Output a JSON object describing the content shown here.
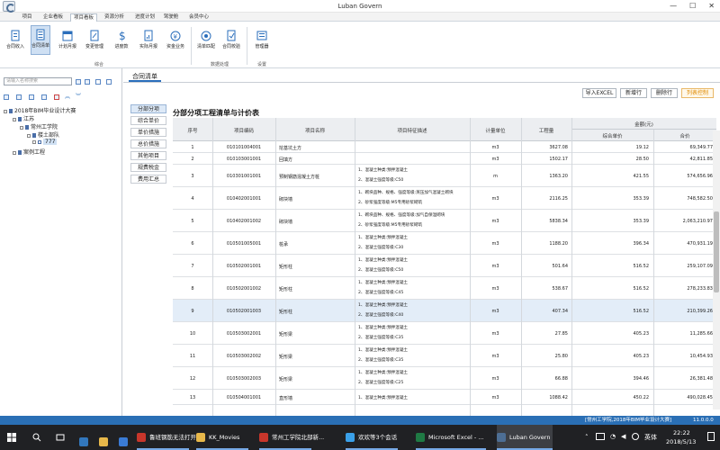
{
  "window": {
    "title": "Luban Govern",
    "controls": [
      "—",
      "☐",
      "✕"
    ]
  },
  "menu": {
    "tabs": [
      "项目",
      "企业看板",
      "项目看板",
      "资源分析",
      "进度计划",
      "驾驶舱",
      "会员中心"
    ],
    "active": 2
  },
  "toolbar": {
    "buttons": [
      {
        "label": "合同收入",
        "icon": "contract-income-icon",
        "color": "#2a6ebb"
      },
      {
        "label": "合同清单",
        "icon": "contract-list-icon",
        "color": "#2a6ebb"
      },
      {
        "label": "计划月报",
        "icon": "monthly-plan-icon",
        "color": "#2a6ebb"
      },
      {
        "label": "变更管理",
        "icon": "change-management-icon",
        "color": "#2a6ebb"
      },
      {
        "label": "进度款",
        "icon": "progress-payment-icon",
        "color": "#2a6ebb"
      },
      {
        "label": "实际月报",
        "icon": "actual-monthly-icon",
        "color": "#2a6ebb"
      },
      {
        "label": "资金业务",
        "icon": "funds-icon",
        "color": "#2a6ebb"
      },
      {
        "label": "清单匹配",
        "icon": "list-match-icon",
        "color": "#2a6ebb"
      },
      {
        "label": "合同校验",
        "icon": "contract-check-icon",
        "color": "#2a6ebb"
      },
      {
        "label": "管理器",
        "icon": "manager-icon",
        "color": "#2a6ebb"
      }
    ],
    "active": 1,
    "groups": [
      "综合",
      "数据处理",
      "设置"
    ]
  },
  "left": {
    "search_placeholder": "请输入名称搜索",
    "tree": [
      {
        "label": "2018年BIM毕业设计大赛",
        "level": 0,
        "kind": "folder"
      },
      {
        "label": "江苏",
        "level": 1,
        "kind": "building"
      },
      {
        "label": "常州工学院",
        "level": 2,
        "kind": "building"
      },
      {
        "label": "楼土部队",
        "level": 3,
        "kind": "building"
      },
      {
        "label": "777",
        "level": 4,
        "kind": "item"
      },
      {
        "label": "案例工程",
        "level": 1,
        "kind": "building"
      }
    ]
  },
  "main": {
    "tab": "合同清单",
    "side_buttons": [
      "分部分项",
      "综合单价",
      "单价措施",
      "总价措施",
      "其他项目",
      "规费税金",
      "费用汇总"
    ],
    "side_active": 0,
    "actions": [
      "导入EXCEL",
      "新增行",
      "删除行",
      "列表控制"
    ],
    "section_title": "分部分项工程清单与计价表",
    "headers": {
      "seq": "序号",
      "code": "项目编码",
      "name": "项目名称",
      "feature": "项目特征描述",
      "unit": "计量单位",
      "qty": "工程量",
      "amount": "金额(元)",
      "unit_price": "综合单价",
      "total": "合价"
    },
    "rows": [
      {
        "seq": "1",
        "code": "010101004001",
        "name": "挖基坑土方",
        "features": [],
        "unit": "m3",
        "qty": "3627.08",
        "unit_price": "19.12",
        "total": "69,349.77"
      },
      {
        "seq": "2",
        "code": "010103001001",
        "name": "回填方",
        "features": [],
        "unit": "m3",
        "qty": "1502.17",
        "unit_price": "28.50",
        "total": "42,811.85"
      },
      {
        "seq": "3",
        "code": "010301001001",
        "name": "预制钢筋混凝土方桩",
        "features": [
          "1、混凝土种类:预拌混凝土",
          "2、混凝土强度等级:C50"
        ],
        "unit": "m",
        "qty": "1363.20",
        "unit_price": "421.55",
        "total": "574,656.96"
      },
      {
        "seq": "4",
        "code": "010402001001",
        "name": "砌块墙",
        "features": [
          "1、砌块品种、规格、强度等级:蒸压加气混凝土砌块",
          "2、砂浆强度等级:M5专用砂浆砌筑"
        ],
        "unit": "m3",
        "qty": "2116.25",
        "unit_price": "353.39",
        "total": "748,582.50"
      },
      {
        "seq": "5",
        "code": "010402001002",
        "name": "砌块墙",
        "features": [
          "1、砌块品种、规格、强度等级:加气自保温砌块",
          "2、砂浆强度等级:M5专用砂浆砌筑"
        ],
        "unit": "m3",
        "qty": "5838.34",
        "unit_price": "353.39",
        "total": "2,063,210.97"
      },
      {
        "seq": "6",
        "code": "010501005001",
        "name": "桩承",
        "features": [
          "1、混凝土种类:预拌混凝土",
          "2、混凝土强度等级:C30"
        ],
        "unit": "m3",
        "qty": "1188.20",
        "unit_price": "396.34",
        "total": "470,931.19"
      },
      {
        "seq": "7",
        "code": "010502001001",
        "name": "矩形柱",
        "features": [
          "1、混凝土种类:预拌混凝土",
          "2、混凝土强度等级:C50"
        ],
        "unit": "m3",
        "qty": "501.64",
        "unit_price": "516.52",
        "total": "259,107.09"
      },
      {
        "seq": "8",
        "code": "010502001002",
        "name": "矩形柱",
        "features": [
          "1、混凝土种类:预拌混凝土",
          "2、混凝土强度等级:C45"
        ],
        "unit": "m3",
        "qty": "538.67",
        "unit_price": "516.52",
        "total": "278,233.83"
      },
      {
        "seq": "9",
        "code": "010502001003",
        "name": "矩形柱",
        "features": [
          "1、混凝土种类:预拌混凝土",
          "2、混凝土强度等级:C40"
        ],
        "unit": "m3",
        "qty": "407.34",
        "unit_price": "516.52",
        "total": "210,399.26"
      },
      {
        "seq": "10",
        "code": "010503002001",
        "name": "矩形梁",
        "features": [
          "1、混凝土种类:预拌混凝土",
          "2、混凝土强度等级:C35"
        ],
        "unit": "m3",
        "qty": "27.85",
        "unit_price": "405.23",
        "total": "11,285.66"
      },
      {
        "seq": "11",
        "code": "010503002002",
        "name": "矩形梁",
        "features": [
          "1、混凝土种类:预拌混凝土",
          "2、混凝土强度等级:C35"
        ],
        "unit": "m3",
        "qty": "25.80",
        "unit_price": "405.23",
        "total": "10,454.93"
      },
      {
        "seq": "12",
        "code": "010503002003",
        "name": "矩形梁",
        "features": [
          "1、混凝土种类:预拌混凝土",
          "2、混凝土强度等级:C25"
        ],
        "unit": "m3",
        "qty": "66.88",
        "unit_price": "394.46",
        "total": "26,381.48"
      },
      {
        "seq": "13",
        "code": "010504001001",
        "name": "直形墙",
        "features": [
          "1、混凝土种类:预拌混凝土"
        ],
        "unit": "m3",
        "qty": "1088.42",
        "unit_price": "450.22",
        "total": "490,028.45"
      }
    ],
    "selected_row": 8
  },
  "status": {
    "project": "[常州工学院,2018年BIM毕业设计大赛]",
    "version": "11.0.0.0"
  },
  "taskbar": {
    "items": [
      {
        "label": "",
        "icon": "start-icon",
        "color": "#ffffff"
      },
      {
        "label": "",
        "icon": "search-icon",
        "color": "#ffffff"
      },
      {
        "label": "",
        "icon": "task-view-icon",
        "color": "#ffffff"
      },
      {
        "label": "",
        "icon": "edge-icon",
        "color": "#3277bc"
      },
      {
        "label": "",
        "icon": "explorer-icon",
        "color": "#e8b84a"
      },
      {
        "label": "",
        "icon": "store-icon",
        "color": "#3a7bd5"
      },
      {
        "label": "鲁班钢筋无法打开...",
        "icon": "app-icon",
        "color": "#c8362b"
      },
      {
        "label": "KK_Movies",
        "icon": "folder-icon",
        "color": "#e8b84a"
      },
      {
        "label": "常州工学院北部新...",
        "icon": "app-icon",
        "color": "#c8362b"
      },
      {
        "label": "欢欢等3个会话",
        "icon": "chat-icon",
        "color": "#3aa0e8"
      },
      {
        "label": "Microsoft Excel - ...",
        "icon": "excel-icon",
        "color": "#1f7a44"
      },
      {
        "label": "Luban Govern",
        "icon": "luban-icon",
        "color": "#4d6e94"
      }
    ],
    "tray": {
      "ime": "英体",
      "time": "22:22",
      "date": "2018/5/13"
    }
  }
}
